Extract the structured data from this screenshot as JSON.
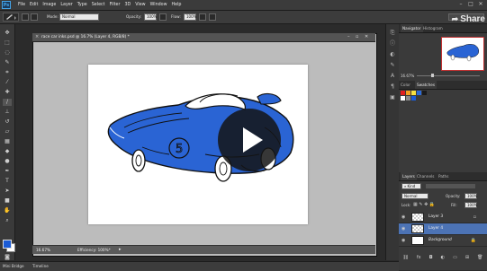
{
  "app": {
    "logo": "Ps",
    "menu": [
      "File",
      "Edit",
      "Image",
      "Layer",
      "Type",
      "Select",
      "Filter",
      "3D",
      "View",
      "Window",
      "Help"
    ],
    "window_controls": [
      "–",
      "□",
      "✕"
    ]
  },
  "options_bar": {
    "mode_label": "Mode:",
    "mode_value": "Normal",
    "opacity_label": "Opacity:",
    "opacity_value": "100%",
    "flow_label": "Flow:",
    "flow_value": "100%"
  },
  "share": {
    "label": "Share",
    "icon": "share-arrow-icon"
  },
  "document": {
    "tab_title": "race car inks.psd @ 16.7% (Layer 4, RGB/8) *",
    "zoom": "16.67%",
    "efficiency": "Efficiency: 100%*"
  },
  "navigator": {
    "tabs": [
      "Navigator",
      "Histogram"
    ],
    "zoom": "16.67%"
  },
  "color_panel": {
    "tabs": [
      "Color",
      "Swatches"
    ],
    "swatches": [
      "#e02020",
      "#f4a020",
      "#f8e040",
      "#2b6ad8",
      "#1a1a1a",
      "#ffffff",
      "#8a8a8a",
      "#1a5bd6"
    ]
  },
  "layers_panel": {
    "tabs": [
      "Layers",
      "Channels",
      "Paths"
    ],
    "kind_label": "Kind",
    "blend_mode": "Normal",
    "opacity_label": "Opacity:",
    "opacity_value": "100%",
    "lock_label": "Lock:",
    "fill_label": "Fill:",
    "fill_value": "100%",
    "layers": [
      {
        "name": "Layer 3",
        "selected": false
      },
      {
        "name": "Layer 4",
        "selected": true
      },
      {
        "name": "Background",
        "selected": false
      }
    ]
  },
  "bottom_tabs": [
    "Mini Bridge",
    "Timeline"
  ],
  "colors": {
    "foreground": "#1a5bd6",
    "background": "#ffffff",
    "car_blue": "#2a64d4"
  }
}
